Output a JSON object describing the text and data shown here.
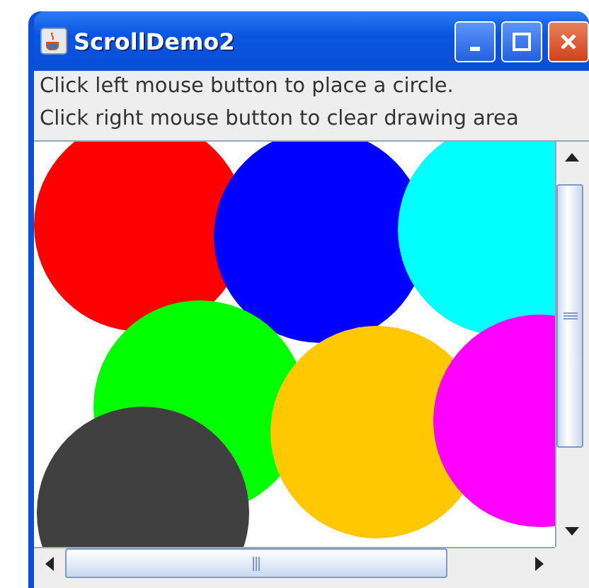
{
  "window": {
    "title": "ScrollDemo2"
  },
  "instructions": [
    "Click left mouse button to place a circle.",
    "Click right mouse button to clear drawing area"
  ],
  "circles": [
    {
      "color": "#ff0000"
    },
    {
      "color": "#0000ff"
    },
    {
      "color": "#00ffff"
    },
    {
      "color": "#00ff00"
    },
    {
      "color": "#ffc800"
    },
    {
      "color": "#ff00ff"
    },
    {
      "color": "#404040"
    }
  ]
}
